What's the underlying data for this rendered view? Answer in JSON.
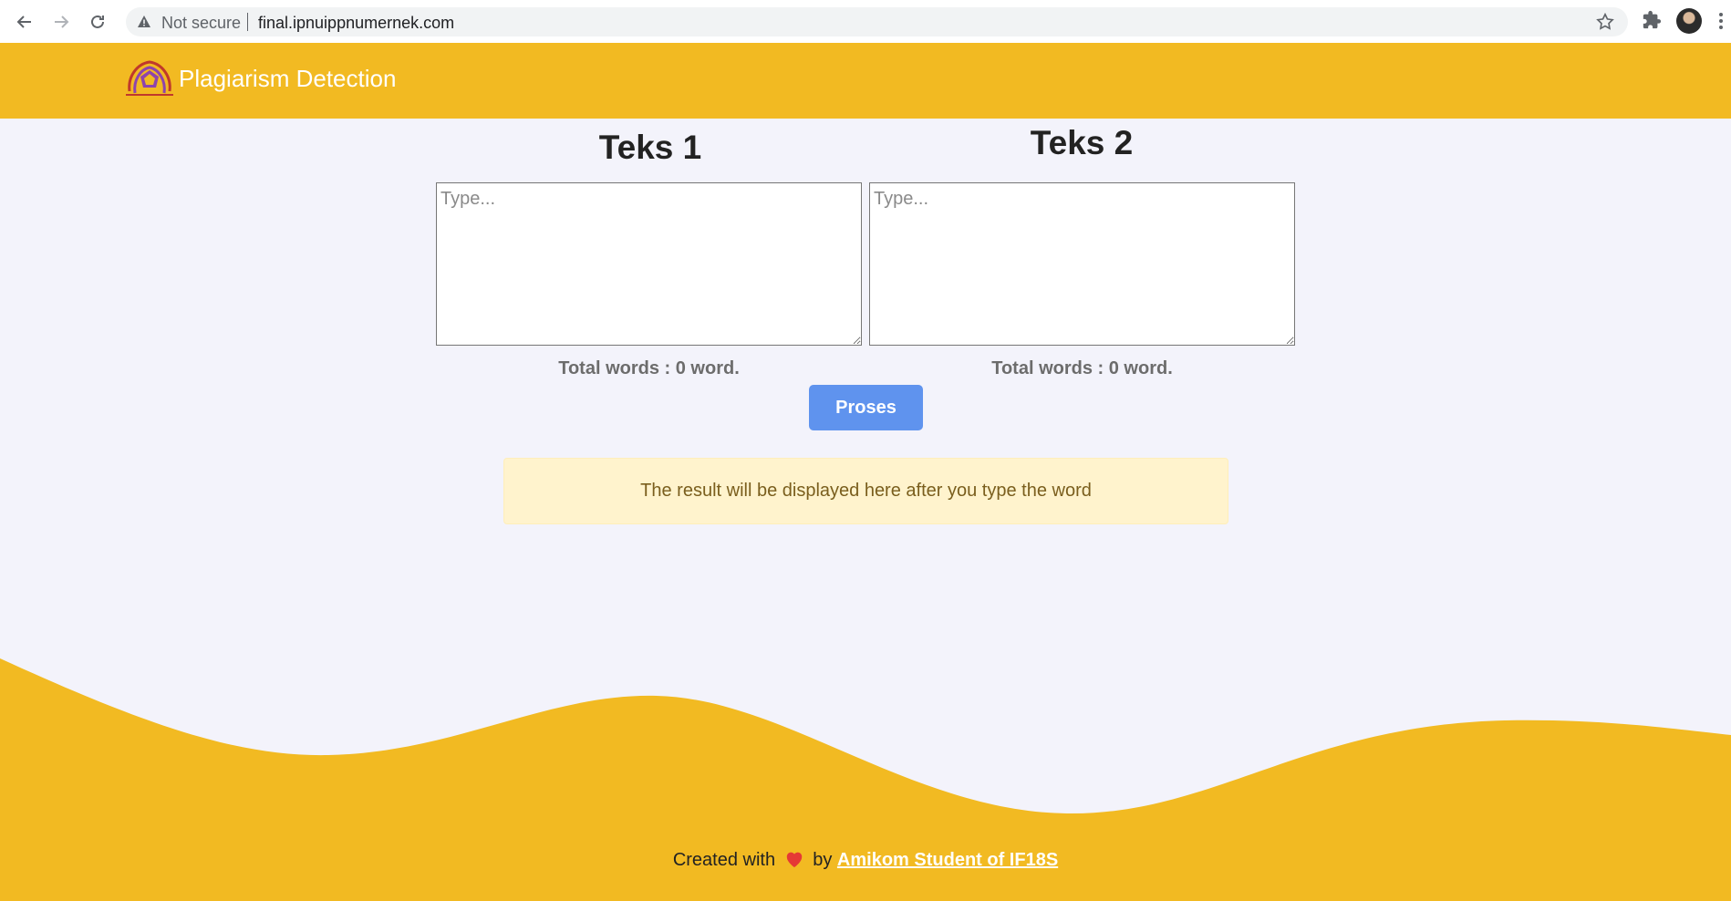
{
  "browser": {
    "security_label": "Not secure",
    "url": "final.ipnuippnumernek.com"
  },
  "header": {
    "brand": "Plagiarism Detection"
  },
  "main": {
    "text1": {
      "title": "Teks 1",
      "placeholder": "Type...",
      "value": "",
      "word_count_label": "Total words : 0 word."
    },
    "text2": {
      "title": "Teks 2",
      "placeholder": "Type...",
      "value": "",
      "word_count_label": "Total words : 0 word."
    },
    "process_button": "Proses",
    "result_message": "The result will be displayed here after you type the word"
  },
  "footer": {
    "prefix": "Created with",
    "by": "by",
    "link_text": "Amikom Student of IF18S"
  },
  "colors": {
    "brand_yellow": "#f2ba22",
    "page_bg": "#f3f3fb",
    "button_blue": "#5f93ee",
    "alert_bg": "#fff3cd",
    "heart_red": "#e53935"
  },
  "icons": [
    "back-arrow-icon",
    "forward-arrow-icon",
    "reload-icon",
    "warning-icon",
    "star-icon",
    "extensions-icon",
    "profile-avatar",
    "menu-kebab-icon",
    "logo-icon",
    "heart-icon"
  ]
}
